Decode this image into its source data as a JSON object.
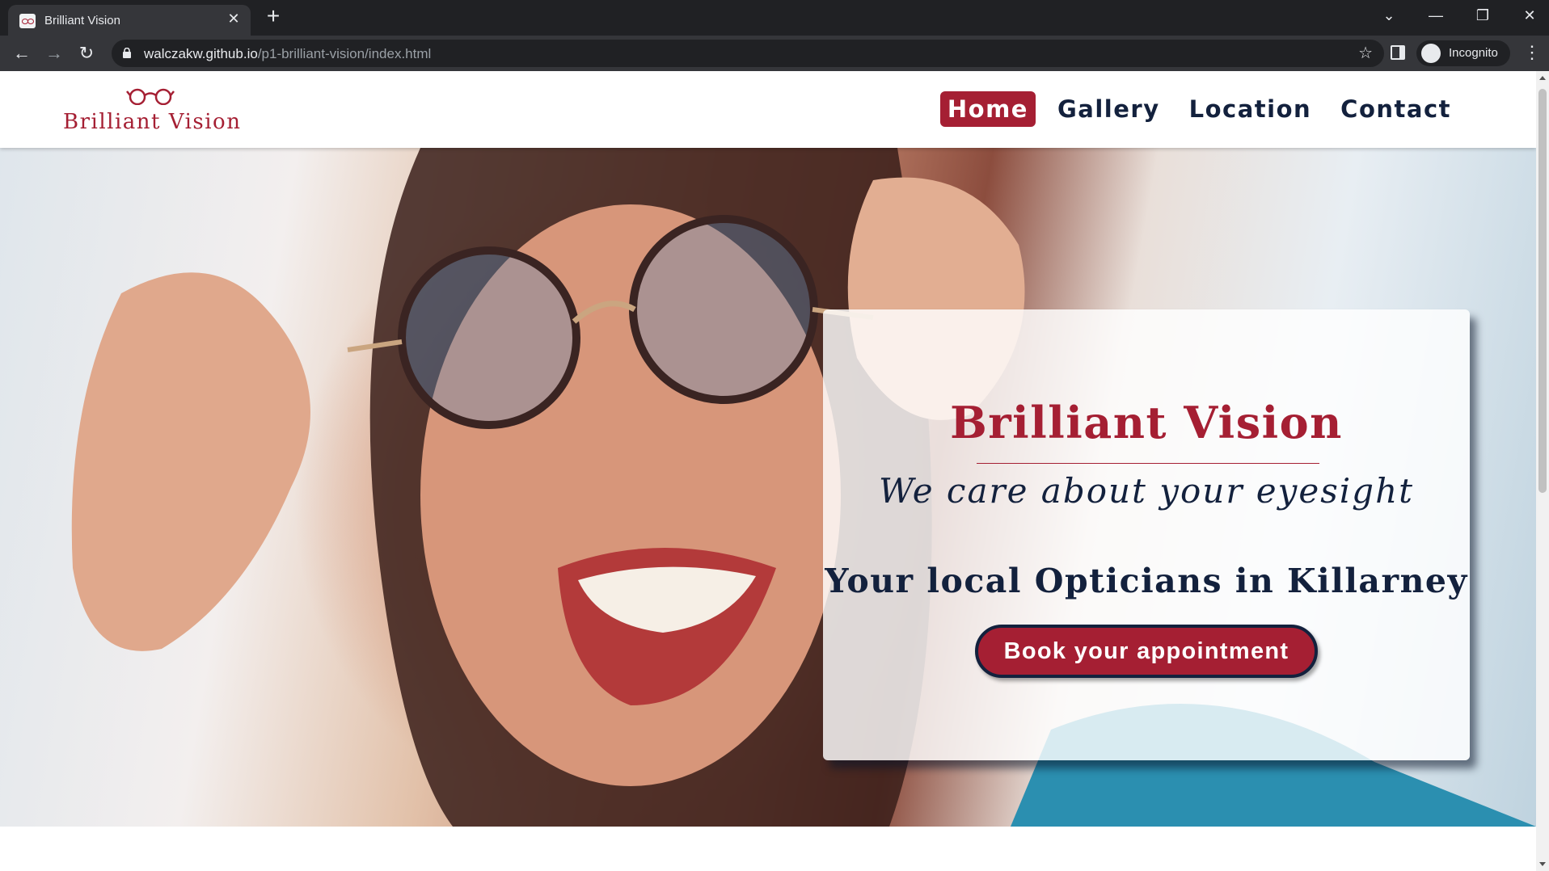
{
  "browser": {
    "tab_title": "Brilliant Vision",
    "url_host": "walczakw.github.io",
    "url_path": "/p1-brilliant-vision/index.html",
    "profile_label": "Incognito"
  },
  "site": {
    "logo_text": "Brilliant Vision",
    "brand_color": "#a51f33",
    "text_color": "#13213d",
    "nav": [
      {
        "label": "Home",
        "active": true
      },
      {
        "label": "Gallery",
        "active": false
      },
      {
        "label": "Location",
        "active": false
      },
      {
        "label": "Contact",
        "active": false
      }
    ]
  },
  "hero": {
    "title": "Brilliant Vision",
    "tagline": "We care about your eyesight",
    "subtitle": "Your local Opticians in Killarney",
    "cta_label": "Book your appointment"
  }
}
